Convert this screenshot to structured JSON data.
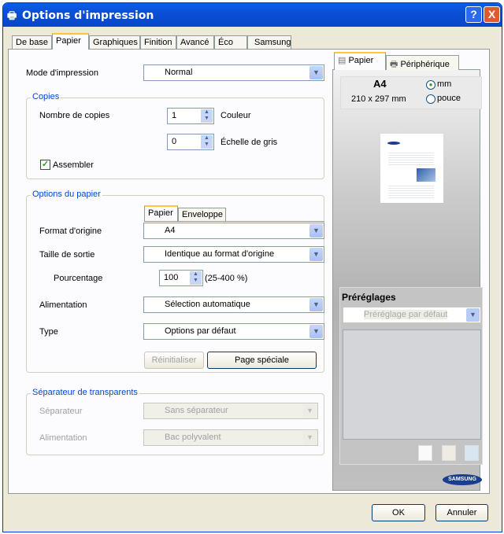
{
  "window": {
    "title": "Options d'impression",
    "help": "?",
    "close": "X"
  },
  "tabs": [
    "De base",
    "Papier",
    "Graphiques",
    "Finition",
    "Avancé",
    "Éco",
    "Samsung"
  ],
  "mode": {
    "label": "Mode d'impression",
    "value": "Normal"
  },
  "copies": {
    "legend": "Copies",
    "label": "Nombre de copies",
    "color_value": "1",
    "color_label": "Couleur",
    "gray_value": "0",
    "gray_label": "Échelle de gris",
    "collate_label": "Assembler",
    "collate_checked": true
  },
  "paper": {
    "legend": "Options du papier",
    "inner_tabs": [
      "Papier",
      "Enveloppe"
    ],
    "format_label": "Format d'origine",
    "format_value": "A4",
    "output_label": "Taille de sortie",
    "output_value": "Identique au format d'origine",
    "percent_label": "Pourcentage",
    "percent_value": "100",
    "percent_range": "(25-400 %)",
    "source_label": "Alimentation",
    "source_value": "Sélection automatique",
    "type_label": "Type",
    "type_value": "Options par défaut",
    "reset": "Réinitialiser",
    "special": "Page spéciale"
  },
  "separator": {
    "legend": "Séparateur de transparents",
    "sep_label": "Séparateur",
    "sep_value": "Sans séparateur",
    "source_label": "Alimentation",
    "source_value": "Bac polyvalent"
  },
  "right": {
    "tabs": [
      "Papier",
      "Périphérique"
    ],
    "size": "A4",
    "dims": "210 x 297 mm",
    "unit_mm": "mm",
    "unit_inch": "pouce",
    "unit_selected": "mm",
    "presets_title": "Préréglages",
    "presets_value": "Préréglage par défaut",
    "brand": "SAMSUNG"
  },
  "footer": {
    "ok": "OK",
    "cancel": "Annuler"
  }
}
